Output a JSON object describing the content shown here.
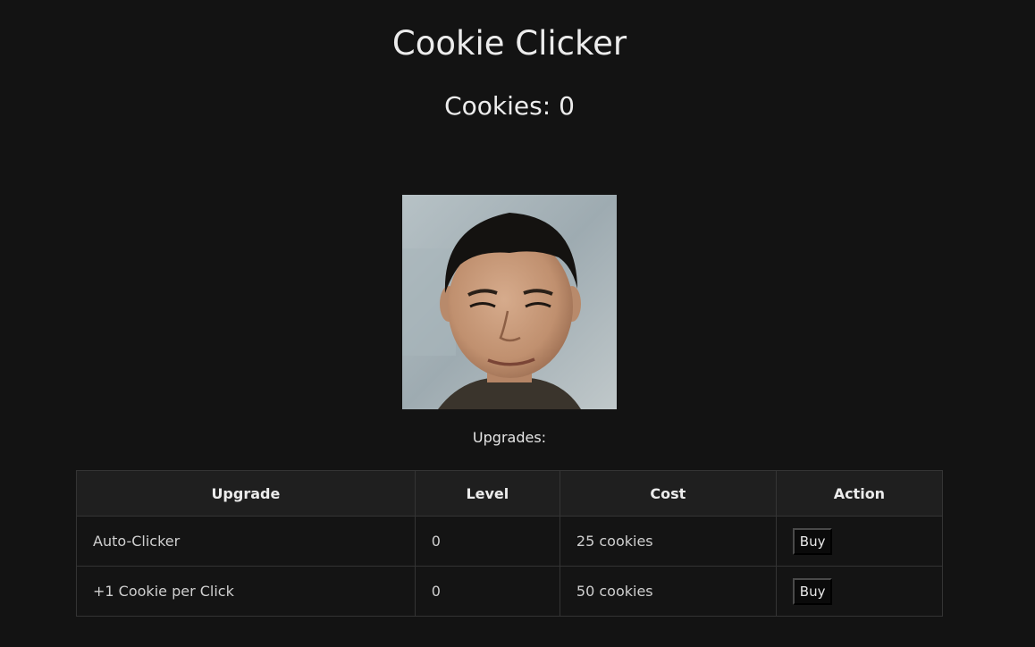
{
  "header": {
    "title": "Cookie Clicker",
    "cookies_label": "Cookies: 0"
  },
  "image": {
    "name": "clickable-portrait"
  },
  "upgrades": {
    "label": "Upgrades:",
    "columns": [
      "Upgrade",
      "Level",
      "Cost",
      "Action"
    ],
    "rows": [
      {
        "name": "Auto-Clicker",
        "level": "0",
        "cost": "25 cookies",
        "action": "Buy"
      },
      {
        "name": "+1 Cookie per Click",
        "level": "0",
        "cost": "50 cookies",
        "action": "Buy"
      }
    ]
  },
  "colors": {
    "background": "#131313",
    "text": "#e6e6e6",
    "table_border": "#343434",
    "header_bg": "#1f1f1f"
  }
}
